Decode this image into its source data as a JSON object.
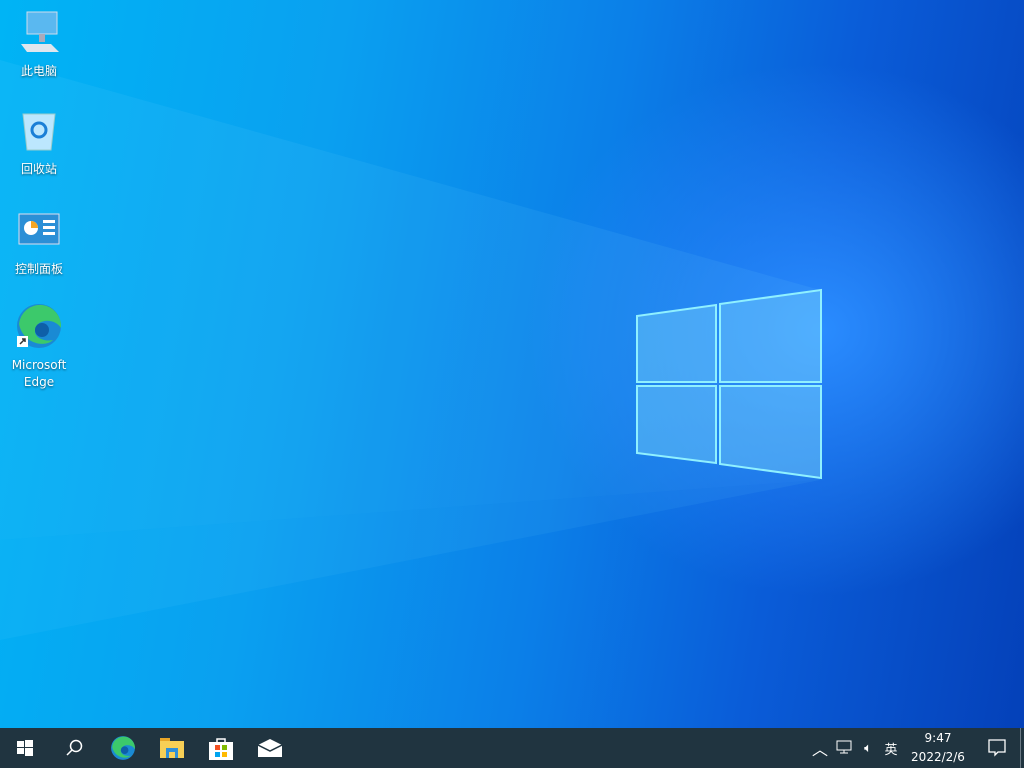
{
  "desktop": {
    "icons": [
      {
        "label": "此电脑",
        "icon": "computer-icon"
      },
      {
        "label": "回收站",
        "icon": "recycle-bin-icon"
      },
      {
        "label": "控制面板",
        "icon": "control-panel-icon"
      },
      {
        "label_line1": "Microsoft",
        "label_line2": "Edge",
        "icon": "edge-icon"
      }
    ]
  },
  "taskbar": {
    "apps": [
      "start",
      "search",
      "edge",
      "file-explorer",
      "microsoft-store",
      "mail"
    ],
    "tray": {
      "ime": "英",
      "time": "9:47",
      "date": "2022/2/6"
    }
  },
  "colors": {
    "taskbar": "#203440",
    "wallpaper": "#0a7fe8"
  }
}
